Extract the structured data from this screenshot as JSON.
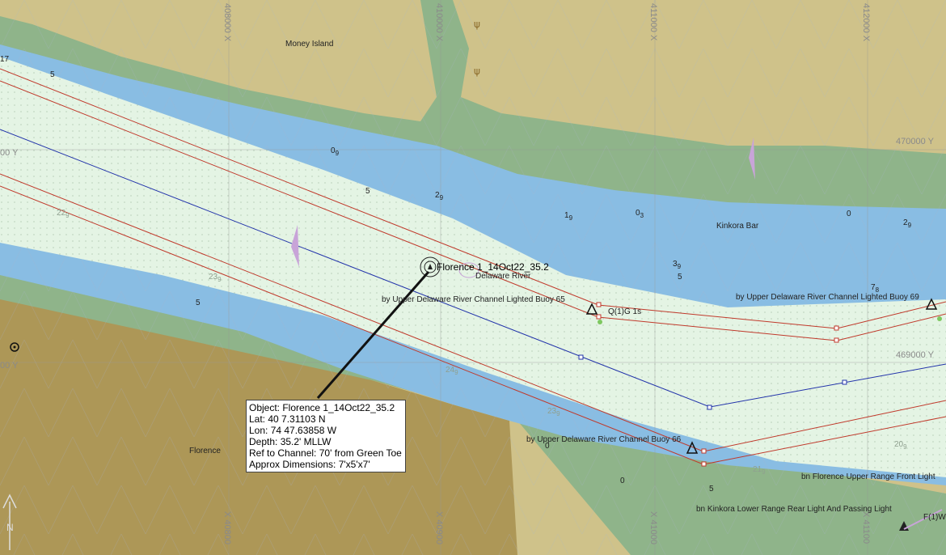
{
  "colors": {
    "land": "#cfc28a",
    "dark_land": "#ad9757",
    "marsh": "#8fb48a",
    "shallow": "#89bde3",
    "channel": "#e4f4e4",
    "channel_edge": "#c0392b",
    "centerline": "#2233aa"
  },
  "grid_labels": {
    "x408": "408000 X",
    "x410": "410000 X",
    "x411": "411000 X",
    "x412": "412000 X",
    "y470_right": "470000 Y",
    "y470_left": "00 Y",
    "y469_right": "469000 Y",
    "y469_left": "00 Y",
    "x408b": "X 40800",
    "x409b": "X 40900",
    "x410b": "X 41000",
    "x411b": "X 41100"
  },
  "place_labels": {
    "money_island": "Money Island",
    "kinkora_bar": "Kinkora Bar",
    "florence": "Florence",
    "delaware_river": "Delaware River"
  },
  "soundings": [
    {
      "v": "5",
      "s": ""
    },
    {
      "v": "0",
      "s": "9"
    },
    {
      "v": "2",
      "s": "9"
    },
    {
      "v": "1",
      "s": "9"
    },
    {
      "v": "0",
      "s": "3"
    },
    {
      "v": "3",
      "s": "9"
    },
    {
      "v": "0",
      "s": ""
    },
    {
      "v": "2",
      "s": "9"
    },
    {
      "v": "5",
      "s": ""
    },
    {
      "v": "7",
      "s": "8"
    },
    {
      "v": "22",
      "s": "9"
    },
    {
      "v": "23",
      "s": "9"
    },
    {
      "v": "24",
      "s": "9"
    },
    {
      "v": "23",
      "s": "9"
    },
    {
      "v": "20",
      "s": "9"
    },
    {
      "v": "21",
      "s": "9"
    },
    {
      "v": "5",
      "s": ""
    },
    {
      "v": "0",
      "s": ""
    },
    {
      "v": "0",
      "s": ""
    },
    {
      "v": "5",
      "s": ""
    },
    {
      "v": "5",
      "s": ""
    },
    {
      "v": "17",
      "s": ""
    }
  ],
  "nav_labels": {
    "buoy65": "by Upper Delaware River Channel Lighted Buoy 65",
    "buoy69": "by Upper Delaware River Channel Lighted Buoy 69",
    "buoy66": "by Upper Delaware River Channel Buoy 66",
    "light_char": "Q(1)G 1s",
    "front_light": "bn Florence Upper Range Front Light",
    "rear_light": "bn Kinkora Lower Range Rear Light And Passing Light",
    "fl_w": "F(1)W"
  },
  "object": {
    "marker_label": "Florence 1_14Oct22_35.2",
    "info": [
      "Object: Florence 1_14Oct22_35.2",
      "Lat: 40 7.31103 N",
      "Lon: 74 47.63858 W",
      "Depth: 35.2' MLLW",
      "Ref to Channel: 70' from Green Toe",
      "Approx Dimensions: 7'x5'x7'"
    ]
  },
  "north_arrow": "N"
}
